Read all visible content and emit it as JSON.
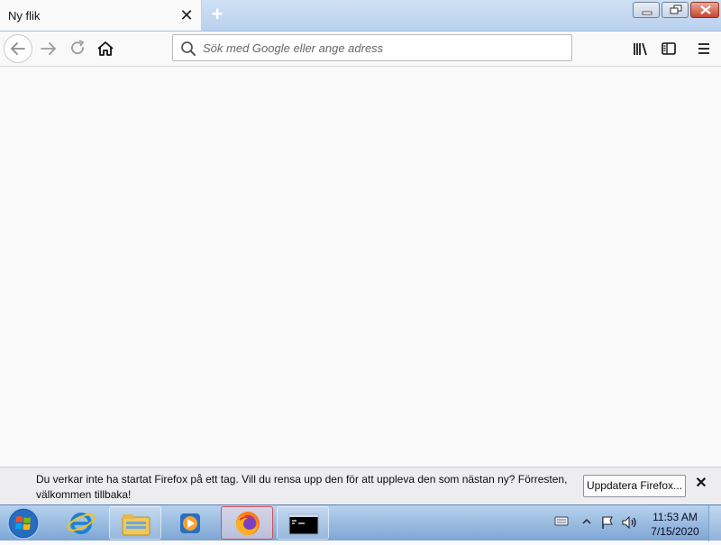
{
  "browser": {
    "tab": {
      "title": "Ny flik",
      "close_glyph": "✕"
    },
    "new_tab_glyph": "+",
    "url": {
      "placeholder": "Sök med Google eller ange adress",
      "value": ""
    },
    "icons": [
      "back-arrow-icon",
      "forward-arrow-icon",
      "reload-icon",
      "home-icon",
      "search-icon",
      "library-icon",
      "sidebar-icon",
      "menu-icon"
    ]
  },
  "notification": {
    "message": "Du verkar inte ha startat Firefox på ett tag. Vill du rensa upp den för att uppleva den som nästan ny? Förresten, välkommen tillbaka!",
    "button": "Uppdatera Firefox...",
    "close_glyph": "✕"
  },
  "taskbar": {
    "items": [
      "internet-explorer",
      "file-explorer",
      "media-player",
      "firefox",
      "command-prompt"
    ],
    "active": "firefox",
    "clock": {
      "time": "11:53 AM",
      "date": "7/15/2020"
    }
  },
  "colors": {
    "tab_active_bg": "#f9f9fa",
    "taskbar_top": "#b7d2ee",
    "notice_bg": "#ededf0",
    "active_task_border": "#d24e5a"
  }
}
